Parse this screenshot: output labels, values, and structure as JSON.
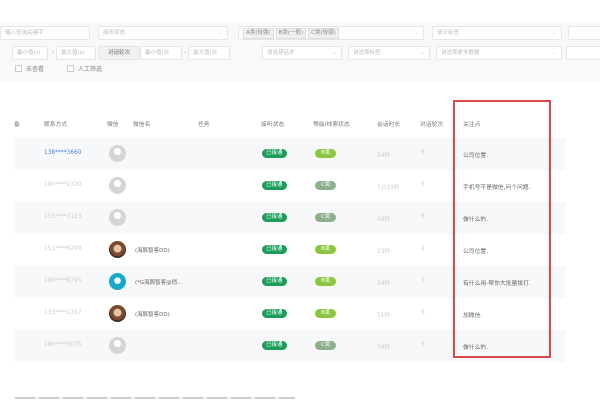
{
  "filters": {
    "keyword_placeholder": "输入查询关键字",
    "answer_status_placeholder": "接听状态",
    "level_tags": [
      "A类(较强)",
      "B类(一般)",
      "C类(较弱)"
    ],
    "semantic_tag_placeholder": "语义标签",
    "min_duration_placeholder": "最小值(s)",
    "max_duration_placeholder": "最大值(s)",
    "rounds_label": "对话轮次",
    "min_rounds_placeholder": "最小值(次",
    "max_rounds_placeholder": "最大值(次",
    "script_placeholder": "请选择话术",
    "tag_placeholder": "请选择标签",
    "more_placeholder": "请选择更多数据",
    "checkbox_unviewed": "未查看",
    "checkbox_manual": "人工筛选"
  },
  "table": {
    "headers": [
      "备",
      "联系方式",
      "微信",
      "微信名",
      "任务",
      "接听状态",
      "等级/线索状态",
      "会话时长",
      "对话轮次",
      "关注点"
    ],
    "rows": [
      {
        "phone": "138****3660",
        "avatar": "default",
        "wechat_name": "",
        "status": "已接通",
        "level": "B类",
        "level_color": "#8cc63f",
        "duration": "54秒",
        "rounds": "6",
        "focus": "公司位置."
      },
      {
        "phone": "180****2320",
        "avatar": "default",
        "wechat_name": "",
        "status": "已接通",
        "level": "C类",
        "level_color": "#8fae8c",
        "duration": "1分19秒",
        "rounds": "5",
        "focus": "手机号不是微信,问个问题."
      },
      {
        "phone": "155****3123",
        "avatar": "default",
        "wechat_name": "",
        "status": "已接通",
        "level": "C类",
        "level_color": "#8fae8c",
        "duration": "58秒",
        "rounds": "6",
        "focus": "做什么的."
      },
      {
        "phone": "151****6290",
        "avatar": "photo",
        "wechat_name": "(海豚智客DD)",
        "status": "已接通",
        "level": "B类",
        "level_color": "#8cc63f",
        "duration": "13秒",
        "rounds": "2",
        "focus": "公司位置."
      },
      {
        "phone": "190****8795",
        "avatar": "teal",
        "wechat_name": "(*G海豚智客@俏...",
        "status": "已接通",
        "level": "B类",
        "level_color": "#8cc63f",
        "duration": "34秒",
        "rounds": "3",
        "focus": "有什么用-帮你大批量拨打."
      },
      {
        "phone": "133****1357",
        "avatar": "photo",
        "wechat_name": "(海豚智客DD)",
        "status": "已接通",
        "level": "B类",
        "level_color": "#8cc63f",
        "duration": "51秒",
        "rounds": "6",
        "focus": "加微信."
      },
      {
        "phone": "186****3075",
        "avatar": "default",
        "wechat_name": "",
        "status": "已接通",
        "level": "C类",
        "level_color": "#8fae8c",
        "duration": "59秒",
        "rounds": "5",
        "focus": "做什么的."
      }
    ]
  },
  "colors": {
    "answered": "#1a9e5a",
    "highlight_box": "#d9484a",
    "link": "#4a7fd6"
  }
}
